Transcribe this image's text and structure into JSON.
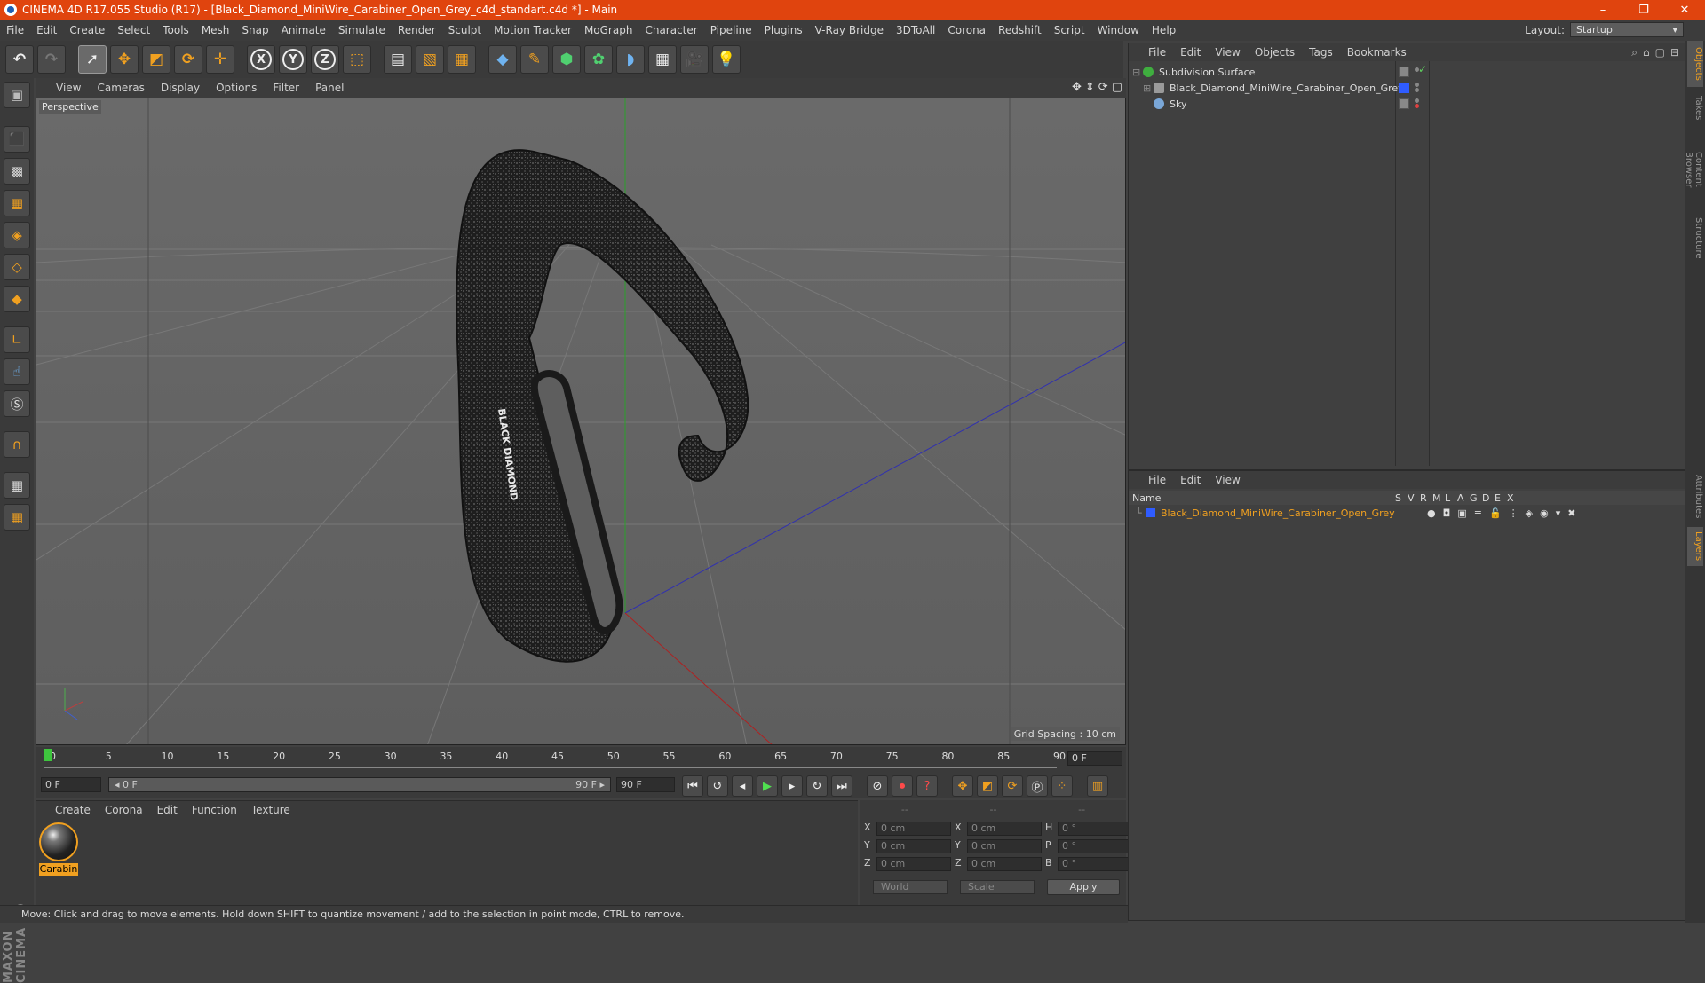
{
  "window": {
    "title": "CINEMA 4D R17.055 Studio (R17) - [Black_Diamond_MiniWire_Carabiner_Open_Grey_c4d_standart.c4d *] - Main",
    "minimize": "–",
    "restore": "❐",
    "close": "✕"
  },
  "menu": [
    "File",
    "Edit",
    "Create",
    "Select",
    "Tools",
    "Mesh",
    "Snap",
    "Animate",
    "Simulate",
    "Render",
    "Sculpt",
    "Motion Tracker",
    "MoGraph",
    "Character",
    "Pipeline",
    "Plugins",
    "V-Ray Bridge",
    "3DToAll",
    "Corona",
    "Redshift",
    "Script",
    "Window",
    "Help"
  ],
  "layout": {
    "label": "Layout:",
    "value": "Startup"
  },
  "toolbar": {
    "x": "X",
    "y": "Y",
    "z": "Z"
  },
  "viewport": {
    "menu": [
      "View",
      "Cameras",
      "Display",
      "Options",
      "Filter",
      "Panel"
    ],
    "label": "Perspective",
    "grid_spacing": "Grid Spacing : 10 cm",
    "model_text": "BLACK DIAMOND"
  },
  "timeline": {
    "ticks": [
      "0",
      "5",
      "10",
      "15",
      "20",
      "25",
      "30",
      "35",
      "40",
      "45",
      "50",
      "55",
      "60",
      "65",
      "70",
      "75",
      "80",
      "85",
      "90"
    ],
    "current": "0 F",
    "start": "0 F",
    "slider_left": "◂ 0 F",
    "slider_right": "90 F ▸",
    "end": "90 F"
  },
  "materials": {
    "menu": [
      "Create",
      "Corona",
      "Edit",
      "Function",
      "Texture"
    ],
    "items": [
      {
        "name": "Carabin"
      }
    ]
  },
  "coords": {
    "headers": [
      "--",
      "--",
      "--"
    ],
    "rows": [
      [
        "X",
        "0 cm",
        "X",
        "0 cm",
        "H",
        "0 °"
      ],
      [
        "Y",
        "0 cm",
        "Y",
        "0 cm",
        "P",
        "0 °"
      ],
      [
        "Z",
        "0 cm",
        "Z",
        "0 cm",
        "B",
        "0 °"
      ]
    ],
    "mode": "World",
    "scale": "Scale",
    "apply": "Apply"
  },
  "status": "Move: Click and drag to move elements. Hold down SHIFT to quantize movement / add to the selection in point mode, CTRL to remove.",
  "objects": {
    "menu": [
      "File",
      "Edit",
      "View",
      "Objects",
      "Tags",
      "Bookmarks"
    ],
    "items": [
      {
        "name": "Subdivision Surface",
        "color": "#3fae3f"
      },
      {
        "name": "Black_Diamond_MiniWire_Carabiner_Open_Grey",
        "color": "#aaaaaa"
      },
      {
        "name": "Sky",
        "color": "#7aa7d8"
      }
    ]
  },
  "layers": {
    "menu": [
      "File",
      "Edit",
      "View"
    ],
    "columns": [
      "Name",
      "S",
      "V",
      "R",
      "M",
      "L",
      "A",
      "G",
      "D",
      "E",
      "X"
    ],
    "items": [
      {
        "name": "Black_Diamond_MiniWire_Carabiner_Open_Grey",
        "color": "#2f5cff"
      }
    ]
  },
  "sidetabs": [
    "Objects",
    "Takes",
    "Content Browser",
    "Structure",
    "Attributes",
    "Layers"
  ],
  "colors": {
    "accent": "#f0a020",
    "title_bar": "#e0440e"
  }
}
